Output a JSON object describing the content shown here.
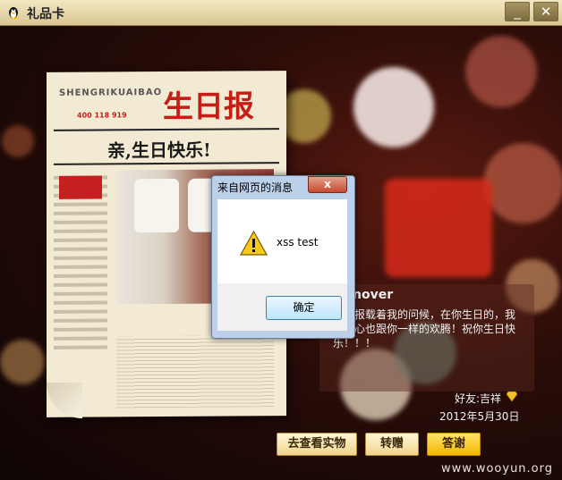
{
  "window": {
    "title": "礼品卡",
    "minimize_glyph": "_",
    "close_glyph": "✕"
  },
  "newspaper": {
    "brand": "SHENGRIKUAIBAO",
    "phone": "400 118 919",
    "masthead": "生日报",
    "headline": "亲,生日快乐!"
  },
  "card": {
    "sender": "nover",
    "message": "日快报载着我的问候，在你生日的，我的内心也跟你一样的欢腾！祝你生日快乐！！！",
    "friend_label": "好友:吉祥",
    "date": "2012年5月30日"
  },
  "buttons": {
    "view_gift": "去查看实物",
    "forward": "转赠",
    "thanks": "答谢"
  },
  "dialog": {
    "title": "来自网页的消息",
    "close_glyph": "x",
    "message": "xss test",
    "ok_label": "确定"
  },
  "watermark": "www.wooyun.org",
  "icons": {
    "app": "qq-penguin-icon",
    "warning": "warning-icon",
    "friend": "diamond-icon"
  },
  "colors": {
    "titlebar": "#e6d6a8",
    "masthead_red": "#c41e16",
    "button_gold": "#f3b500",
    "dialog_frame": "#bcd0ea"
  }
}
